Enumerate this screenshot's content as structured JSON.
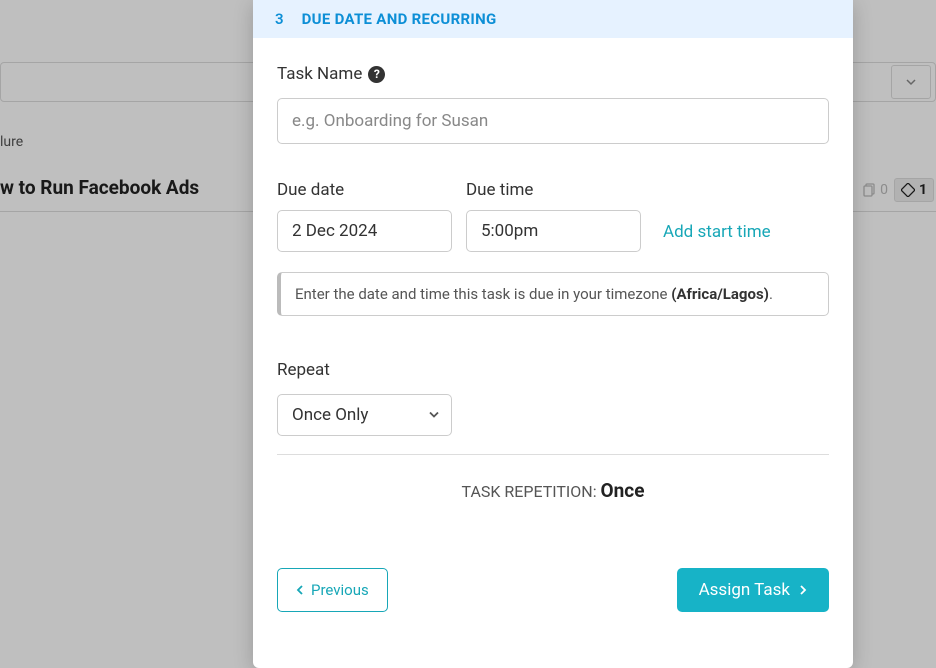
{
  "background": {
    "breadcrumb": "lure",
    "page_title": "w to Run Facebook Ads",
    "stat_copy": "0",
    "stat_diamond": "1"
  },
  "modal": {
    "step_number": "3",
    "step_title": "DUE DATE AND RECURRING",
    "task_name": {
      "label": "Task Name",
      "placeholder": "e.g. Onboarding for Susan",
      "value": ""
    },
    "due_date": {
      "label": "Due date",
      "value": "2 Dec 2024"
    },
    "due_time": {
      "label": "Due time",
      "value": "5:00pm"
    },
    "add_start_time": "Add start time",
    "hint_prefix": "Enter the date and time this task is due in your timezone ",
    "hint_tz": "(Africa/Lagos)",
    "hint_suffix": ".",
    "repeat": {
      "label": "Repeat",
      "selected": "Once Only"
    },
    "rep_summary_label": "TASK REPETITION: ",
    "rep_summary_value": "Once",
    "prev_label": "Previous",
    "assign_label": "Assign Task"
  }
}
